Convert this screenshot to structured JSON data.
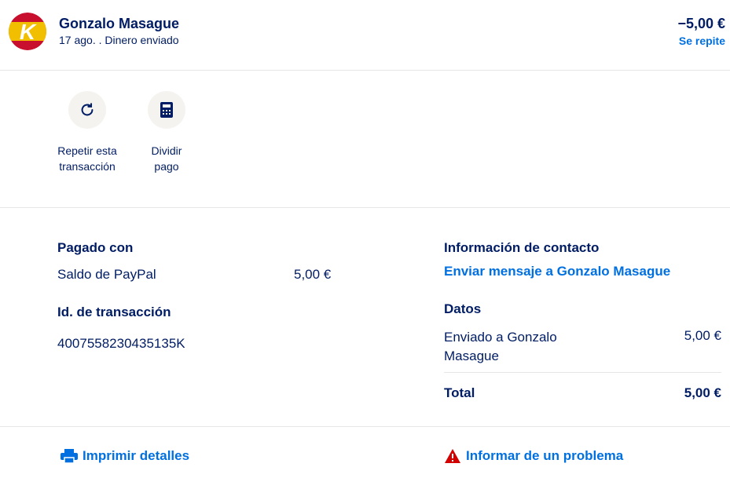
{
  "header": {
    "name": "Gonzalo Masague",
    "subtitle": "17 ago. . Dinero enviado",
    "amount": "−5,00 €",
    "repeat_label": "Se repite",
    "avatar_letter": "K"
  },
  "actions": [
    {
      "label": "Repetir esta transacción",
      "icon": "refresh-icon"
    },
    {
      "label": "Dividir pago",
      "icon": "calculator-icon"
    }
  ],
  "paid_with": {
    "heading": "Pagado con",
    "method": "Saldo de PayPal",
    "amount": "5,00 €"
  },
  "transaction_id": {
    "heading": "Id. de transacción",
    "value": "4007558230435135K"
  },
  "contact": {
    "heading": "Información de contacto",
    "link": "Enviar mensaje a Gonzalo Masague"
  },
  "data_section": {
    "heading": "Datos",
    "line_label": "Enviado a Gonzalo Masague",
    "line_amount": "5,00 €",
    "total_label": "Total",
    "total_amount": "5,00 €"
  },
  "footer": {
    "print_label": "Imprimir detalles",
    "report_label": "Informar de un problema"
  },
  "colors": {
    "primary_text": "#001c64",
    "link": "#0070e0",
    "warning": "#d20000",
    "icon_bg": "#f4f3ef"
  }
}
